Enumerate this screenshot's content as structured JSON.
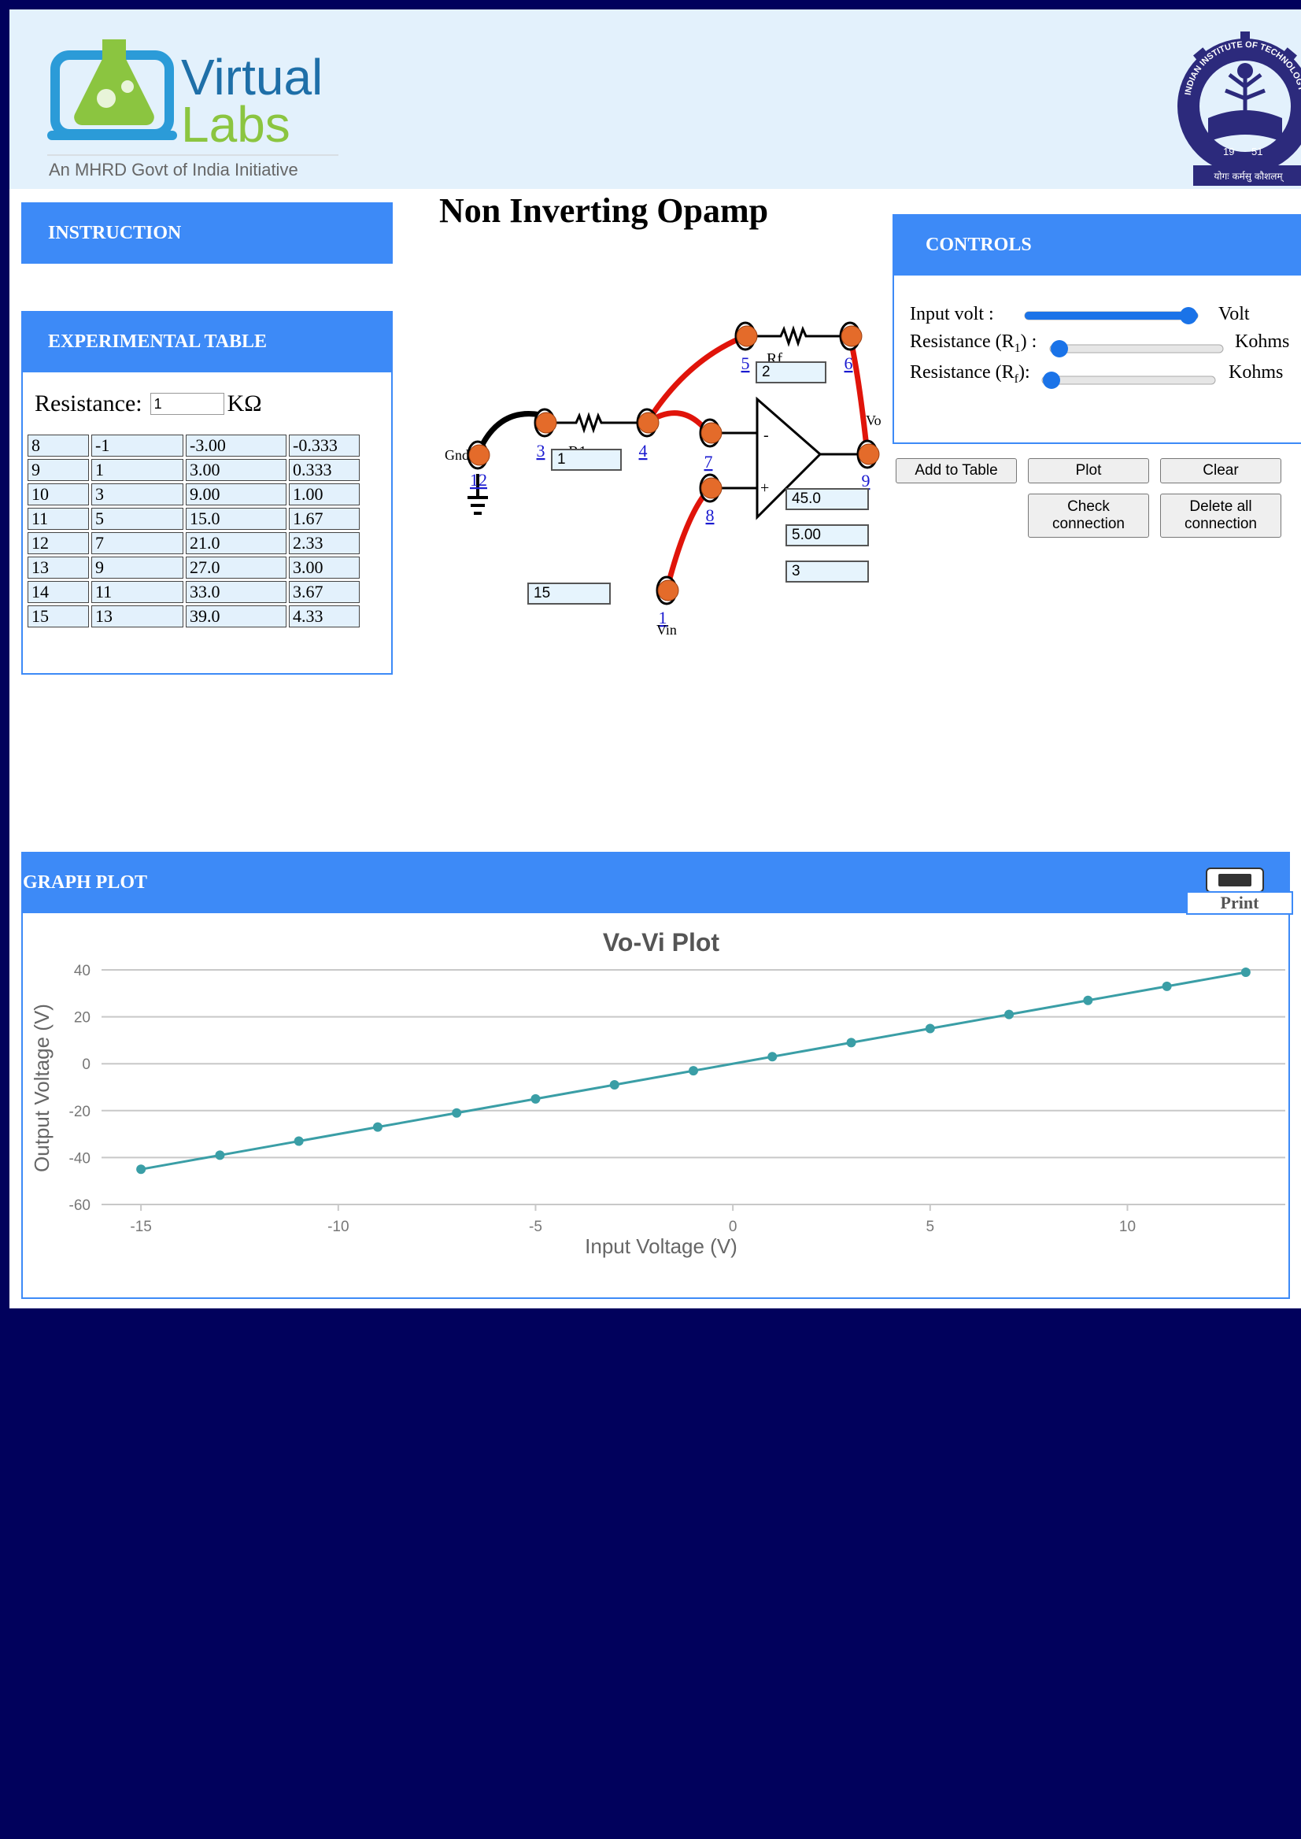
{
  "header": {
    "logo_word1": "Virtual",
    "logo_word2": "Labs",
    "logo_tagline": "An MHRD Govt of India Initiative",
    "emblem_text_top": "INDIAN INSTITUTE OF TECHNOLOGY",
    "emblem_year_left": "19",
    "emblem_year_right": "51",
    "emblem_motto": "योगः कर्मसु कौशलम्"
  },
  "page_title": "Non Inverting Opamp",
  "instruction": {
    "label": "INSTRUCTION"
  },
  "experimental_table": {
    "label": "EXPERIMENTAL TABLE",
    "resistance_label": "Resistance:",
    "resistance_value": "1",
    "resistance_unit": "KΩ",
    "rows": [
      [
        "8",
        "-1",
        "-3.00",
        "-0.333"
      ],
      [
        "9",
        "1",
        "3.00",
        "0.333"
      ],
      [
        "10",
        "3",
        "9.00",
        "1.00"
      ],
      [
        "11",
        "5",
        "15.0",
        "1.67"
      ],
      [
        "12",
        "7",
        "21.0",
        "2.33"
      ],
      [
        "13",
        "9",
        "27.0",
        "3.00"
      ],
      [
        "14",
        "11",
        "33.0",
        "3.67"
      ],
      [
        "15",
        "13",
        "39.0",
        "4.33"
      ]
    ]
  },
  "circuit": {
    "gnd_label": "Gnd",
    "vin_label": "Vin",
    "vo_label": "Vo",
    "r1_label": "R1",
    "rf_label": "Rf",
    "minus": "-",
    "plus": "+",
    "terminals": [
      "12",
      "3",
      "4",
      "5",
      "6",
      "7",
      "8",
      "9",
      "1"
    ],
    "r1_value": "1",
    "rf_value": "2",
    "vin_value": "15",
    "out_values": [
      "45.0",
      "5.00",
      "3"
    ]
  },
  "controls": {
    "label": "CONTROLS",
    "input_volt_label": "Input volt :",
    "input_volt_unit": "Volt",
    "input_volt_level": 1.0,
    "r1_label_pre": "Resistance (R",
    "r1_sub": "1",
    "r1_label_post": ") :",
    "r1_unit": "Kohms",
    "r1_level": 0.0,
    "rf_label_pre": "Resistance (R",
    "rf_sub": "f",
    "rf_label_post": "):",
    "rf_unit": "Kohms",
    "rf_level": 0.0,
    "buttons": {
      "add": "Add to Table",
      "plot": "Plot",
      "clear": "Clear",
      "check_1": "Check",
      "check_2": "connection",
      "delete_1": "Delete all",
      "delete_2": "connection"
    }
  },
  "graph": {
    "label": "GRAPH PLOT",
    "print": "Print"
  },
  "colors": {
    "accent": "#3d8af7",
    "wire_red": "#e0140a",
    "series": "#3a9ea6",
    "page_bg": "#01015c"
  },
  "chart_data": {
    "type": "line",
    "title": "Vo-Vi Plot",
    "xlabel": "Input Voltage (V)",
    "ylabel": "Output Voltage (V)",
    "xlim": [
      -16,
      14
    ],
    "ylim": [
      -60,
      40
    ],
    "xticks": [
      -15,
      -10,
      -5,
      0,
      5,
      10
    ],
    "yticks": [
      -60,
      -40,
      -20,
      0,
      20,
      40
    ],
    "grid": "horizontal",
    "x": [
      -15,
      -13,
      -11,
      -9,
      -7,
      -5,
      -3,
      -1,
      1,
      3,
      5,
      7,
      9,
      11,
      13
    ],
    "y": [
      -45,
      -39,
      -33,
      -27,
      -21,
      -15,
      -9,
      -3,
      3,
      9,
      15,
      21,
      27,
      33,
      39
    ]
  }
}
